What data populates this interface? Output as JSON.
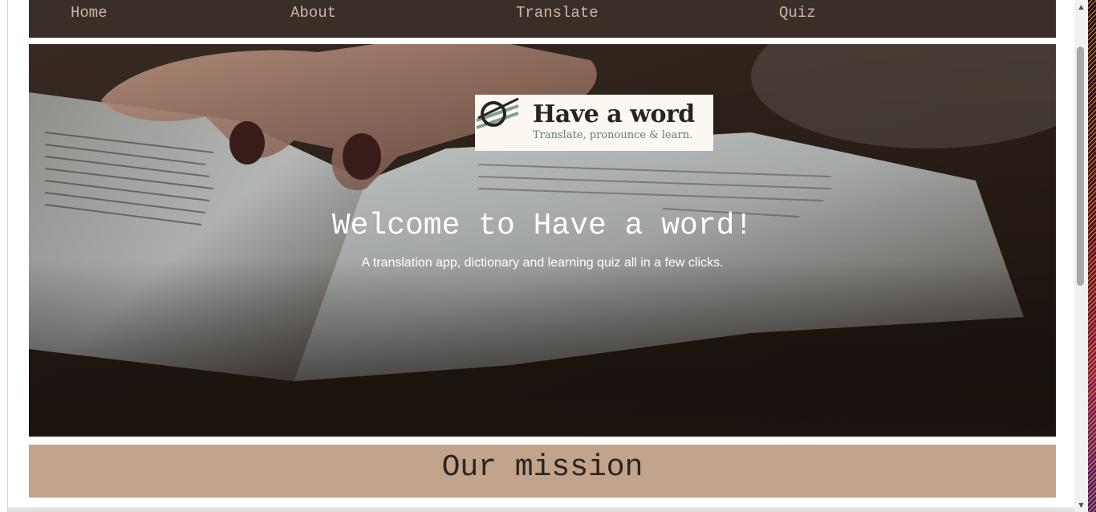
{
  "nav": {
    "items": [
      {
        "label": "Home"
      },
      {
        "label": "About"
      },
      {
        "label": "Translate"
      },
      {
        "label": "Quiz"
      }
    ]
  },
  "logo": {
    "title": "Have a word",
    "tagline": "Translate, pronounce & learn."
  },
  "hero": {
    "heading": "Welcome to Have a word!",
    "subheading": "A translation app, dictionary and learning quiz all in a few clicks.",
    "background_image": "person-reading-open-book-photo"
  },
  "mission": {
    "title": "Our mission"
  },
  "scrollbar": {
    "up_glyph": "▲",
    "down_glyph": "▼"
  },
  "colors": {
    "nav_bg": "#3a2e28",
    "nav_text": "#c9b6a4",
    "mission_bg": "#c2a38c",
    "logo_accent": "#7fa090"
  }
}
